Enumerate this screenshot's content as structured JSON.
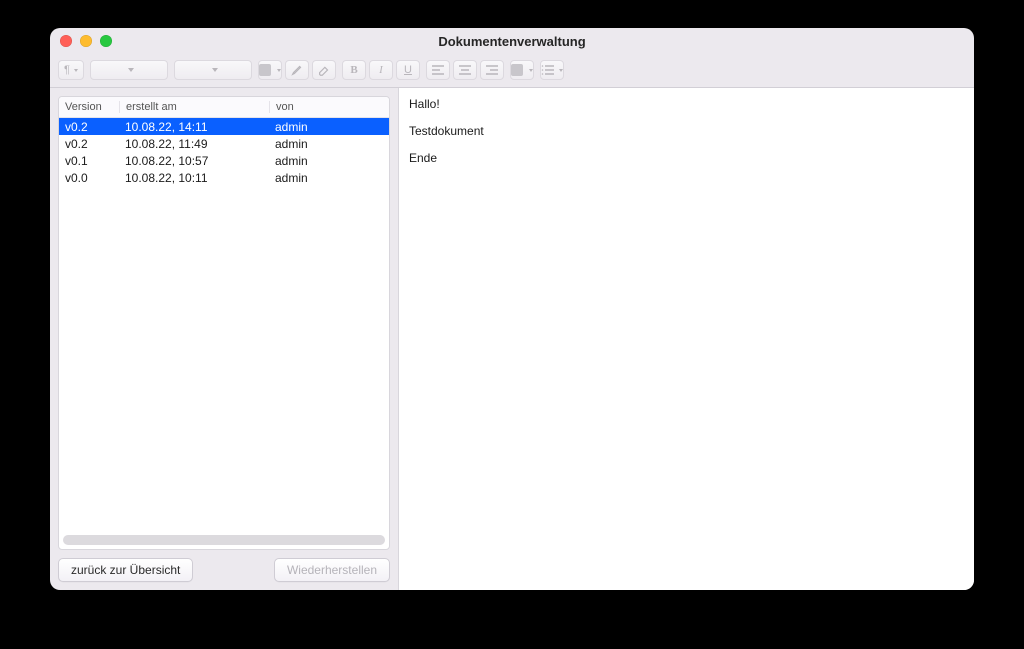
{
  "window": {
    "title": "Dokumentenverwaltung"
  },
  "toolbar": {
    "bold": "B",
    "italic": "I",
    "underline": "U"
  },
  "table": {
    "headers": {
      "version": "Version",
      "created": "erstellt am",
      "by": "von"
    },
    "rows": [
      {
        "version": "v0.2",
        "created": "10.08.22, 14:11",
        "by": "admin",
        "selected": true
      },
      {
        "version": "v0.2",
        "created": "10.08.22, 11:49",
        "by": "admin",
        "selected": false
      },
      {
        "version": "v0.1",
        "created": "10.08.22, 10:57",
        "by": "admin",
        "selected": false
      },
      {
        "version": "v0.0",
        "created": "10.08.22, 10:11",
        "by": "admin",
        "selected": false
      }
    ]
  },
  "buttons": {
    "back": "zurück zur Übersicht",
    "restore": "Wiederherstellen"
  },
  "document": {
    "lines": [
      "Hallo!",
      "Testdokument",
      "Ende"
    ]
  }
}
